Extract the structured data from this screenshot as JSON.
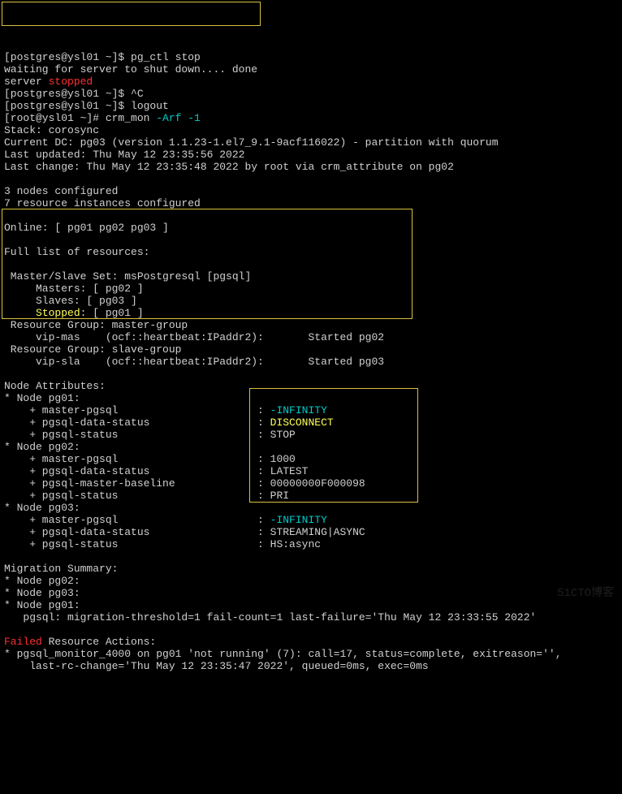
{
  "lines": {
    "l1_prompt": "[postgres@ysl01 ~]$ ",
    "l1_cmd": "pg_ctl stop",
    "l2": "waiting for server to shut down.... done",
    "l3_a": "server ",
    "l3_b": "stopped",
    "l4_prompt": "[postgres@ysl01 ~]$ ",
    "l4_cmd": "^C",
    "l5_prompt": "[postgres@ysl01 ~]$ ",
    "l5_cmd": "logout",
    "l6_prompt": "[root@ysl01 ~]# ",
    "l6_cmd": "crm_mon ",
    "l6_args": "-Arf -1",
    "l7": "Stack: corosync",
    "l8": "Current DC: pg03 (version 1.1.23-1.el7_9.1-9acf116022) - partition with quorum",
    "l9": "Last updated: Thu May 12 23:35:56 2022",
    "l10": "Last change: Thu May 12 23:35:48 2022 by root via crm_attribute on pg02",
    "l11": "3 nodes configured",
    "l12": "7 resource instances configured",
    "l13": "Online: [ pg01 pg02 pg03 ]",
    "l14": "Full list of resources:",
    "l15": " Master/Slave Set: msPostgresql [pgsql]",
    "l16": "     Masters: [ pg02 ]",
    "l17": "     Slaves: [ pg03 ]",
    "l18_a": "     ",
    "l18_b": "Stopped",
    "l18_c": ": [ pg01 ]",
    "l19": " Resource Group: master-group",
    "l20": "     vip-mas    (ocf::heartbeat:IPaddr2):       Started pg02",
    "l21": " Resource Group: slave-group",
    "l22": "     vip-sla    (ocf::heartbeat:IPaddr2):       Started pg03",
    "l23": "Node Attributes:",
    "l24": "* Node pg01:",
    "l25_a": "    + master-pgsql                      : ",
    "l25_b": "-INFINITY",
    "l26_a": "    + pgsql-data-status                 : ",
    "l26_b": "DISCONNECT",
    "l27": "    + pgsql-status                      : STOP",
    "l28": "* Node pg02:",
    "l29": "    + master-pgsql                      : 1000",
    "l30": "    + pgsql-data-status                 : LATEST",
    "l31": "    + pgsql-master-baseline             : 00000000F000098",
    "l32": "    + pgsql-status                      : PRI",
    "l33": "* Node pg03:",
    "l34_a": "    + master-pgsql                      : ",
    "l34_b": "-INFINITY",
    "l35": "    + pgsql-data-status                 : STREAMING|ASYNC",
    "l36": "    + pgsql-status                      : HS:async",
    "l37": "Migration Summary:",
    "l38": "* Node pg02:",
    "l39": "* Node pg03:",
    "l40": "* Node pg01:",
    "l41": "   pgsql: migration-threshold=1 fail-count=1 last-failure='Thu May 12 23:33:55 2022'",
    "l42_a": "Failed",
    "l42_b": " Resource Actions:",
    "l43": "* pgsql_monitor_4000 on pg01 'not running' (7): call=17, status=complete, exitreason='',",
    "l44": "    last-rc-change='Thu May 12 23:35:47 2022', queued=0ms, exec=0ms",
    "watermark": "51CTO博客"
  }
}
